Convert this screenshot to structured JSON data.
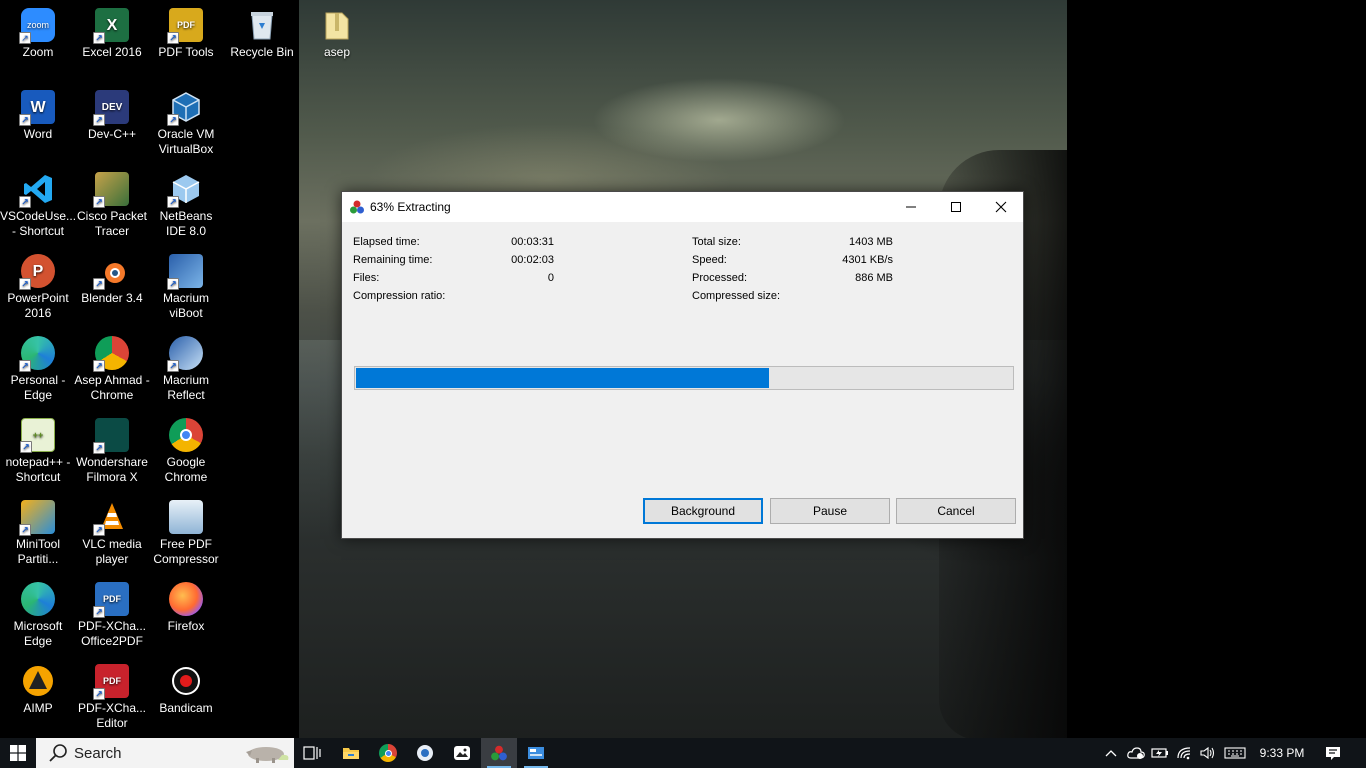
{
  "desktop": {
    "icons": [
      {
        "label": "Zoom"
      },
      {
        "label": "Excel 2016"
      },
      {
        "label": "PDF Tools"
      },
      {
        "label": "Recycle Bin"
      },
      {
        "label": "asep"
      },
      {
        "label": "Word"
      },
      {
        "label": "Dev-C++"
      },
      {
        "label": "Oracle VM VirtualBox"
      },
      {
        "label": "VSCodeUse... - Shortcut"
      },
      {
        "label": "Cisco Packet Tracer"
      },
      {
        "label": "NetBeans IDE 8.0"
      },
      {
        "label": "PowerPoint 2016"
      },
      {
        "label": "Blender 3.4"
      },
      {
        "label": "Macrium viBoot"
      },
      {
        "label": "Personal - Edge"
      },
      {
        "label": "Asep Ahmad - Chrome"
      },
      {
        "label": "Macrium Reflect"
      },
      {
        "label": "notepad++ - Shortcut"
      },
      {
        "label": "Wondershare Filmora X"
      },
      {
        "label": "Google Chrome"
      },
      {
        "label": "MiniTool Partiti..."
      },
      {
        "label": "VLC media player"
      },
      {
        "label": "Free PDF Compressor"
      },
      {
        "label": "Microsoft Edge"
      },
      {
        "label": "PDF-XCha... Office2PDF"
      },
      {
        "label": "Firefox"
      },
      {
        "label": "AIMP"
      },
      {
        "label": "PDF-XCha... Editor"
      },
      {
        "label": "Bandicam"
      }
    ],
    "icon_glyphs": {
      "zoom": "zoom",
      "excel": "X",
      "pdftools": "PDF",
      "word": "W",
      "devcpp": "DEV",
      "powerpoint": "P",
      "pdfxchange": "PDF"
    }
  },
  "dialog": {
    "title": "63% Extracting",
    "progress": 0.63,
    "stats_left": [
      {
        "label": "Elapsed time:",
        "value": "00:03:31"
      },
      {
        "label": "Remaining time:",
        "value": "00:02:03"
      },
      {
        "label": "Files:",
        "value": "0"
      },
      {
        "label": "Compression ratio:",
        "value": ""
      }
    ],
    "stats_right": [
      {
        "label": "Total size:",
        "value": "1403 MB"
      },
      {
        "label": "Speed:",
        "value": "4301 KB/s"
      },
      {
        "label": "Processed:",
        "value": "886 MB"
      },
      {
        "label": "Compressed size:",
        "value": ""
      }
    ],
    "buttons": {
      "background": "Background",
      "pause": "Pause",
      "cancel": "Cancel"
    },
    "controls": {
      "minimize": "—",
      "maximize": "☐",
      "close": "✕"
    }
  },
  "taskbar": {
    "search_placeholder": "Search",
    "clock": "9:33 PM",
    "accent": "#0078d7"
  }
}
